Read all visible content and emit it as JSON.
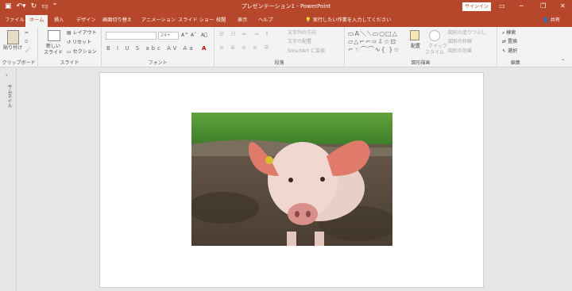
{
  "titlebar": {
    "title": "プレゼンテーション1  -  PowerPoint",
    "signin": "サインイン",
    "qat": [
      "save-icon",
      "undo-icon",
      "redo-icon",
      "start-from-beginning-icon",
      "customize-icon"
    ],
    "qat_glyphs": [
      "▣",
      "↶▾",
      "↻",
      "▭̣",
      "⁼"
    ],
    "win_glyphs": [
      "▭",
      "─",
      "❐",
      "✕"
    ]
  },
  "tabs": [
    {
      "label": "ファイル"
    },
    {
      "label": "ホーム"
    },
    {
      "label": "挿入"
    },
    {
      "label": "デザイン"
    },
    {
      "label": "画面切り替え"
    },
    {
      "label": "アニメーション"
    },
    {
      "label": "スライド ショー"
    },
    {
      "label": "校閲"
    },
    {
      "label": "表示"
    },
    {
      "label": "ヘルプ"
    }
  ],
  "tell_me": "実行したい作業を入力してください",
  "share": "共有",
  "ribbon": {
    "clipboard": {
      "label": "クリップボード",
      "paste": "貼り付け"
    },
    "slides": {
      "label": "スライド",
      "new_slide_1": "新しい",
      "new_slide_2": "スライド",
      "layout": "レイアウト",
      "reset": "リセット",
      "section": "セクション"
    },
    "font": {
      "label": "フォント",
      "size_placeholder": "24+",
      "grow": "A^",
      "shrink": "Aˇ",
      "clear": "A⃠",
      "row2": "B I U S abc AV Aa",
      "color": "A"
    },
    "paragraph": {
      "label": "段落",
      "text_direction": "文字列の方向",
      "align_text": "文字の配置",
      "smartart": "SmartArt に変換"
    },
    "drawing": {
      "label": "図形描画",
      "arrange": "配置",
      "quick_styles_1": "クイック",
      "quick_styles_2": "スタイル",
      "fill": "図形の塗りつぶし",
      "outline": "図形の枠線",
      "effects": "図形の効果"
    },
    "editing": {
      "label": "編集",
      "find": "検索",
      "replace": "置換",
      "select": "選択"
    }
  },
  "rail": {
    "label": "サムネイル"
  },
  "colors": {
    "accent": "#b7472a",
    "ribbon_bg": "#f3f3f3",
    "workspace": "#e6e6e6"
  }
}
